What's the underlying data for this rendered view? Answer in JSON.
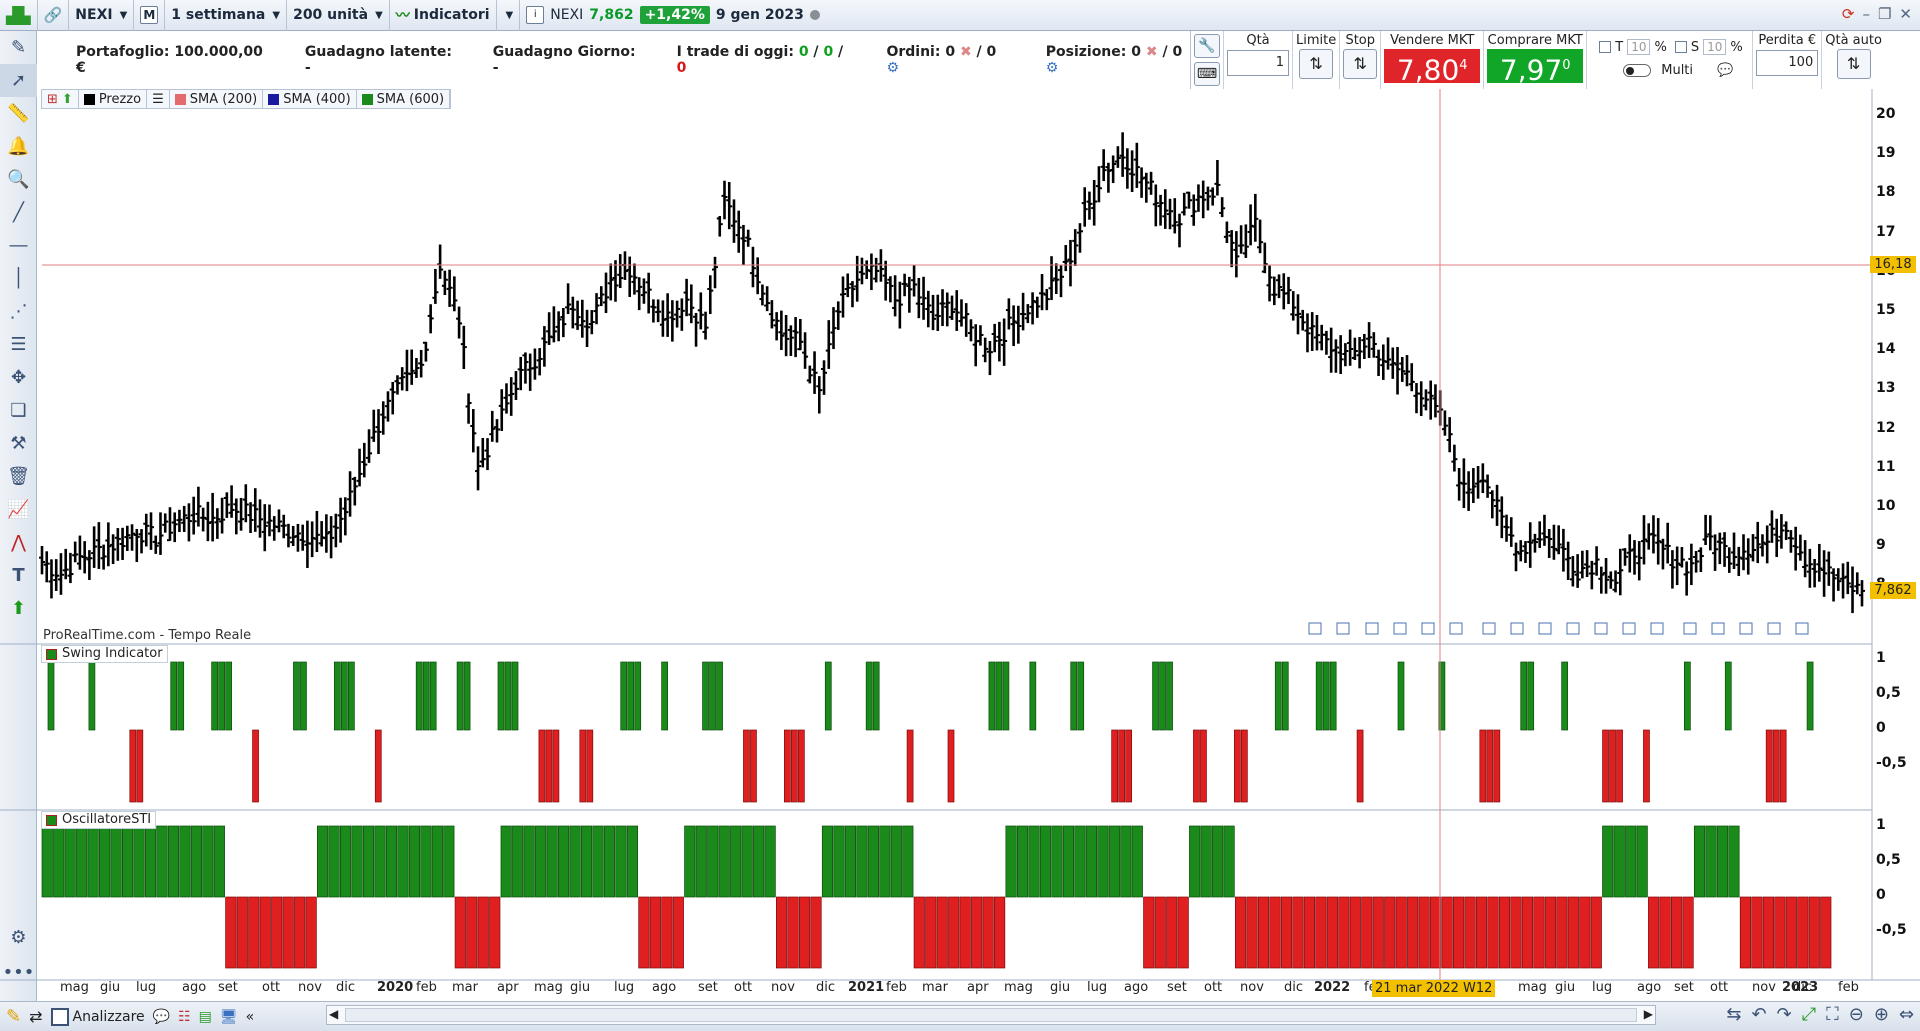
{
  "topbar": {
    "symbol": "NEXI",
    "mode": "M",
    "period": "1 settimana",
    "units": "200 unità",
    "indicators": "Indicatori",
    "quote_symbol": "NEXI",
    "quote_price": "7,862",
    "quote_change": "+1,42%",
    "quote_date": "9 gen 2023"
  },
  "info": {
    "portfolio": "Portafoglio: 100.000,00 €",
    "latent_gain": "Guadagno latente: -",
    "day_gain": "Guadagno Giorno: -",
    "trades_label": "I trade di oggi:",
    "trades_a": "0",
    "trades_b": "0",
    "trades_c": "0",
    "orders_label": "Ordini: 0",
    "orders_b": "/ 0",
    "position_label": "Posizione: 0",
    "position_b": "/ 0"
  },
  "trade": {
    "qty_label": "Qtà",
    "qty_value": "1",
    "limit_label": "Limite",
    "stop_label": "Stop",
    "sell_label": "Vendere MKT",
    "sell_price": "7,80",
    "sell_sup": "4",
    "buy_label": "Comprare MKT",
    "buy_price": "7,97",
    "buy_sup": "0",
    "t_label": "T",
    "t_value": "10",
    "s_label": "S",
    "s_value": "10",
    "pct": "%",
    "multi_label": "Multi",
    "loss_label": "Perdita €",
    "loss_value": "100",
    "auto_qty_label": "Qtà auto"
  },
  "legend": {
    "price": "Prezzo",
    "sma200": "SMA (200)",
    "sma400": "SMA (400)",
    "sma600": "SMA (600)",
    "color_price": "#000000",
    "color_sma200": "#e36b6b",
    "color_sma400": "#1a1aa0",
    "color_sma600": "#1a8a1a"
  },
  "watermark": "ProRealTime.com - Tempo Reale",
  "panels": {
    "swing": "Swing Indicator",
    "sti": "OscillatoreSTI"
  },
  "price_axis": [
    "20",
    "19",
    "18",
    "17",
    "16",
    "15",
    "14",
    "13",
    "12",
    "11",
    "10",
    "9",
    "8"
  ],
  "crosshair_price": "16,18",
  "last_price_tag": "7,862",
  "swing_axis": [
    "1",
    "0,5",
    "0",
    "-0,5"
  ],
  "sti_axis": [
    "1",
    "0,5",
    "0",
    "-0,5"
  ],
  "time_axis": [
    "mag",
    "giu",
    "lug",
    "ago",
    "set",
    "ott",
    "nov",
    "dic",
    "2020",
    "feb",
    "mar",
    "apr",
    "mag",
    "giu",
    "lug",
    "ago",
    "set",
    "ott",
    "nov",
    "dic",
    "2021",
    "feb",
    "mar",
    "apr",
    "mag",
    "giu",
    "lug",
    "ago",
    "set",
    "ott",
    "nov",
    "dic",
    "2022",
    "fe",
    "mag",
    "giu",
    "lug",
    "ago",
    "set",
    "ott",
    "nov",
    "dic",
    "2023",
    "feb"
  ],
  "crosshair_date": "21 mar 2022 W12",
  "bottombar": {
    "analyze": "Analizzare"
  },
  "colors": {
    "bull": "#1a8a1a",
    "bear": "#e02020",
    "crosshair": "#e08080"
  },
  "chart_data": {
    "type": "bar",
    "title": "",
    "series": [
      {
        "name": "Prezzo",
        "values": [
          8.6,
          8.3,
          8.7,
          8.9,
          9.1,
          9.4,
          9.2,
          9.6,
          9.8,
          9.7,
          10.0,
          9.8,
          9.6,
          9.4,
          9.3,
          9.1,
          9.9,
          11.2,
          12.4,
          13.1,
          13.6,
          16.2,
          14.8,
          11.0,
          12.0,
          13.2,
          13.8,
          14.4,
          15.2,
          14.7,
          15.8,
          16.1,
          15.4,
          14.9,
          15.3,
          14.6,
          17.8,
          17.0,
          15.6,
          14.4,
          14.2,
          12.9,
          15.0,
          15.8,
          16.0,
          15.3,
          15.6,
          14.8,
          15.2,
          14.5,
          14.1,
          14.6,
          15.1,
          15.4,
          16.1,
          17.4,
          18.6,
          19.0,
          18.4,
          17.8,
          17.4,
          17.9,
          18.1,
          16.2,
          17.2,
          15.6,
          15.2,
          14.4,
          14.1,
          13.8,
          14.3,
          13.6,
          13.4,
          12.8,
          12.1,
          10.4,
          10.9,
          9.6,
          8.9,
          9.3,
          9.0,
          8.4,
          8.6,
          8.1,
          8.9,
          9.1,
          8.7,
          8.5,
          9.2,
          8.8,
          9.0,
          9.1,
          9.6,
          8.7,
          8.4,
          8.0,
          7.86
        ]
      },
      {
        "name": "Swing Indicator",
        "values": [
          1,
          1,
          -1,
          1,
          1,
          -1,
          1,
          1,
          -1,
          1,
          1,
          1,
          -1,
          -1,
          1,
          1,
          1,
          -1,
          -1,
          1,
          1,
          -1,
          -1,
          1,
          1,
          1,
          -1,
          1,
          -1,
          -1,
          1,
          1,
          -1,
          1,
          1,
          -1,
          1,
          1,
          -1,
          -1,
          1,
          1,
          -1,
          1
        ]
      },
      {
        "name": "OscillatoreSTI",
        "values": [
          1,
          1,
          1,
          1,
          -1,
          -1,
          1,
          1,
          1,
          -1,
          1,
          1,
          1,
          -1,
          1,
          1,
          -1,
          1,
          1,
          -1,
          -1,
          1,
          1,
          1,
          -1,
          1,
          -1,
          -1,
          -1,
          -1,
          -1,
          -1,
          -1,
          -1,
          1,
          -1,
          1,
          -1,
          -1
        ]
      }
    ],
    "ylim": [
      8,
      20
    ]
  }
}
